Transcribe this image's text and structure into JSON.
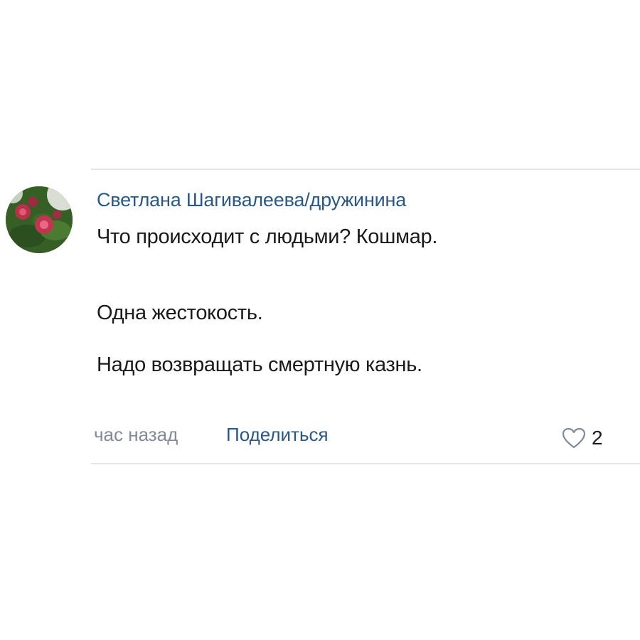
{
  "comment": {
    "author": "Светлана Шагивалеева/дружинина",
    "lines": [
      "Что происходит с людьми? Кошмар.",
      "Одна жестокость.",
      "Надо возвращать смертную казнь."
    ],
    "timestamp": "час назад",
    "share_label": "Поделиться",
    "likes": "2",
    "like_icon": "heart-outline-icon",
    "avatar_icon": "flower-avatar"
  },
  "colors": {
    "link": "#2a5885",
    "meta": "#828a99",
    "text": "#1a1a1a",
    "divider": "#e3e6ea"
  }
}
